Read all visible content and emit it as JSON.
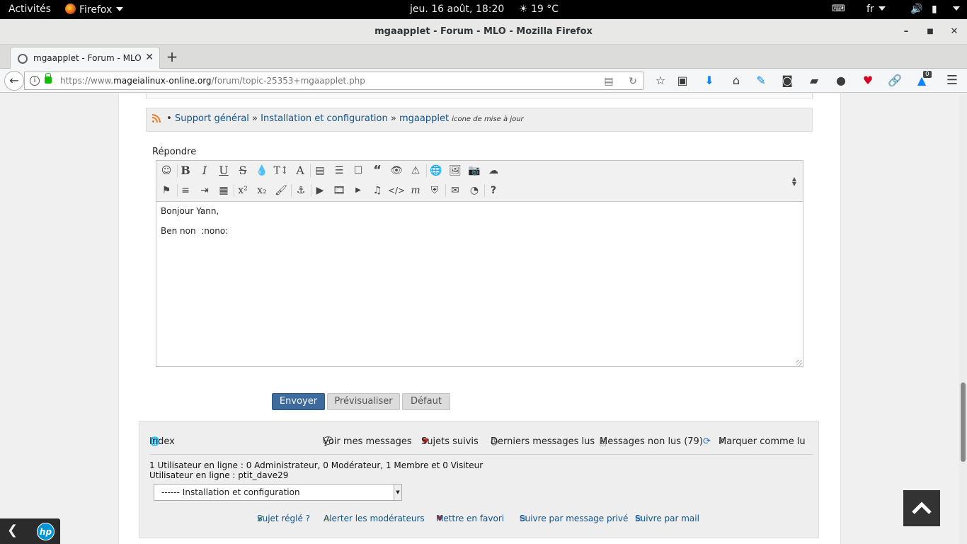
{
  "topbar": {
    "activities": "Activités",
    "app": "Firefox",
    "clock": "jeu. 16 août, 18:20",
    "weather": "19 °C",
    "lang": "fr"
  },
  "window": {
    "title": "mgaapplet - Forum - MLO - Mozilla Firefox"
  },
  "tab": {
    "label": "mgaapplet - Forum - MLO",
    "close": "✕",
    "new": "+"
  },
  "nav": {
    "url_prefix": "https://www.",
    "url_domain": "mageialinux-online.org",
    "url_path": "/forum/topic-25353+mgaapplet.php",
    "badge_count": "0"
  },
  "breadcrumb": {
    "bullet": "•",
    "items": [
      "Support général",
      "Installation et configuration",
      "mgaapplet"
    ],
    "separator": "»",
    "subtitle": "icone de mise à jour"
  },
  "editor": {
    "label": "Répondre",
    "lines": [
      "Bonjour Yann,",
      "Ben non  :nono:"
    ]
  },
  "buttons": {
    "send": "Envoyer",
    "preview": "Prévisualiser",
    "default": "Défaut"
  },
  "footer": {
    "index": "Index",
    "my_messages": "Voir mes messages",
    "followed": "Sujets suivis",
    "last_read": "Derniers messages lus",
    "unread": "Messages non lus (79)",
    "mark_read": "Marquer comme lu",
    "online_line1": "1 Utilisateur en ligne : 0 Administrateur, 0 Modérateur, 1 Membre et 0 Visiteur",
    "online_line2": "Utilisateur en ligne : ptit_dave29",
    "jump_selected": "------ Installation et configuration",
    "solved": "Sujet réglé ?",
    "alert": "Alerter les modérateurs",
    "favorite": "Mettre en favori",
    "follow_pm": "Suivre par message privé",
    "follow_mail": "Suivre par mail"
  }
}
